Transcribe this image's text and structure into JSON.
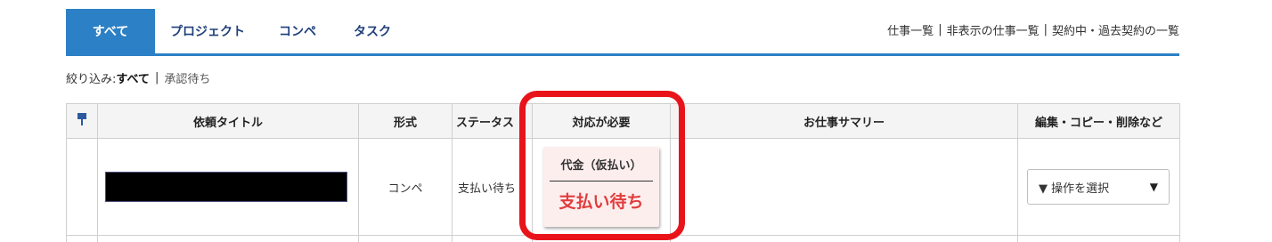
{
  "tabs": [
    {
      "label": "すべて"
    },
    {
      "label": "プロジェクト"
    },
    {
      "label": "コンペ"
    },
    {
      "label": "タスク"
    }
  ],
  "top_links": [
    {
      "label": "仕事一覧"
    },
    {
      "label": "非表示の仕事一覧"
    },
    {
      "label": "契約中・過去契約の一覧"
    }
  ],
  "separator": "|",
  "filter": {
    "prefix": "絞り込み:",
    "current": "すべて",
    "option": "承認待ち"
  },
  "table": {
    "headers": {
      "title": "依頼タイトル",
      "format": "形式",
      "status": "ステータス",
      "action": "対応が必要",
      "summary": "お仕事サマリー",
      "edit": "編集・コピー・削除など"
    },
    "rows": [
      {
        "format": "コンペ",
        "status": "支払い待ち",
        "action_small": "代金（仮払い）",
        "action_big": "支払い待ち",
        "operation": "▼ 操作を選択",
        "caret": "▼"
      }
    ]
  },
  "colors": {
    "accent": "#2c80c5",
    "highlight": "#e8141a",
    "alert_text": "#e23c3c"
  },
  "icons": {
    "pin": "pin-icon",
    "dropdown": "caret-down-icon"
  }
}
